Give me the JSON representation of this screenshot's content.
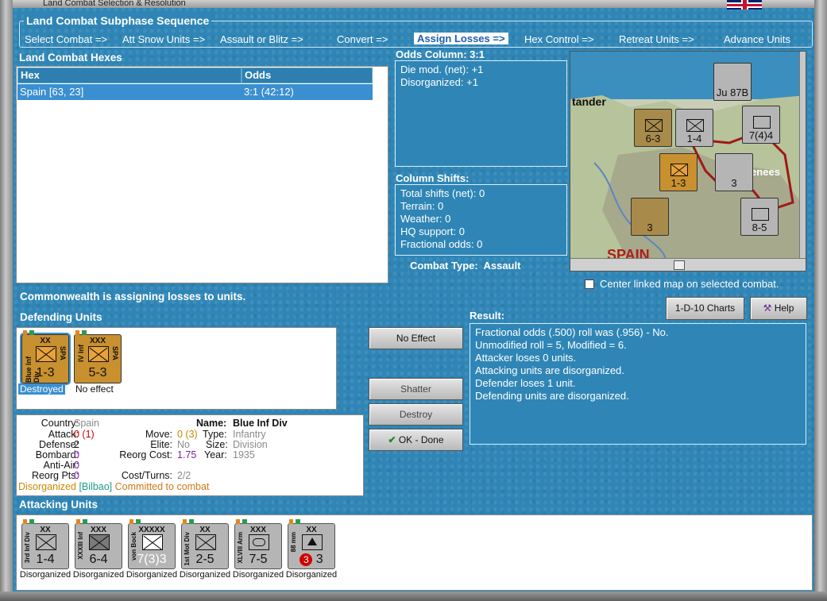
{
  "window": {
    "title": "Land Combat Selection & Resolution"
  },
  "sequence": {
    "title": "Land Combat Subphase Sequence",
    "steps": [
      "Select Combat =>",
      "Att Snow Units =>",
      "Assault or Blitz =>",
      "Convert =>",
      "Assign Losses =>",
      "Hex Control =>",
      "Retreat Units =>",
      "Advance Units"
    ],
    "active_index": 4
  },
  "hexes": {
    "title": "Land Combat Hexes",
    "columns": [
      "Hex",
      "Odds"
    ],
    "rows": [
      {
        "hex": "Spain [63, 23]",
        "odds": "3:1 (42:12)"
      }
    ]
  },
  "odds": {
    "title": "Odds Column: 3:1",
    "lines": [
      "Die mod. (net): +1",
      "Disorganized: +1"
    ]
  },
  "shifts": {
    "title": "Column Shifts:",
    "lines": [
      "Total shifts (net): 0",
      "Terrain: 0",
      "Weather: 0",
      "HQ support: 0",
      "Fractional odds: 0"
    ]
  },
  "combat_type": {
    "label": "Combat Type:",
    "value": "Assault"
  },
  "map": {
    "labels": [
      "tander",
      "renees",
      "SPAIN"
    ],
    "center_checkbox_label": "Center linked map on selected combat.",
    "center_checked": false
  },
  "status_message": "Commonwealth is assigning losses to units.",
  "buttons": {
    "charts": "1-D-10 Charts",
    "help": "Help",
    "no_effect": "No Effect",
    "shatter": "Shatter",
    "destroy": "Destroy",
    "ok": "OK - Done"
  },
  "defending": {
    "title": "Defending Units",
    "units": [
      {
        "side_label": "Blue Inf Div",
        "size": "XX",
        "nation": "SPA",
        "strength": "1-3",
        "status": "Destroyed",
        "selected": true
      },
      {
        "side_label": "IV Inf",
        "size": "XXX",
        "nation": "SPA",
        "strength": "5-3",
        "status": "No effect",
        "selected": false
      }
    ]
  },
  "details": {
    "country_label": "Country:",
    "country": "Spain",
    "attack_label": "Attack:",
    "attack": "0 (1)",
    "defense_label": "Defense:",
    "defense": "2",
    "bombard_label": "Bombard:",
    "bombard": "0",
    "antiair_label": "Anti-Air:",
    "antiair": "0",
    "reorg_label": "Reorg Pts:",
    "reorg": "0",
    "name_label": "Name:",
    "name": "Blue Inf Div",
    "move_label": "Move:",
    "move": "0 (3)",
    "elite_label": "Elite:",
    "elite": "No",
    "reorg_cost_label": "Reorg Cost:",
    "reorg_cost": "1.75",
    "cost_turns_label": "Cost/Turns:",
    "cost_turns": "2/2",
    "type_label": "Type:",
    "type": "Infantry",
    "size_label": "Size:",
    "size": "Division",
    "year_label": "Year:",
    "year": "1935",
    "flag_disorganized": "Disorganized",
    "flag_location": "[Bilbao]",
    "flag_committed": "Committed to combat"
  },
  "result": {
    "title": "Result:",
    "lines": [
      "Fractional odds (.500) roll was (.956)  - No.",
      "Unmodified roll = 5, Modified = 6.",
      "Attacker loses 0 units.",
      "Attacking units are disorganized.",
      "Defender loses 1 unit.",
      "Defending units are disorganized."
    ]
  },
  "attacking": {
    "title": "Attacking Units",
    "units": [
      {
        "side_label": "3rd Inf Div",
        "size": "XX",
        "strength": "1-4",
        "status": "Disorganized",
        "kind": "inf"
      },
      {
        "side_label": "XXXIII Inf",
        "size": "XXX",
        "strength": "6-4",
        "status": "Disorganized",
        "kind": "inf-dark"
      },
      {
        "side_label": "von Bock",
        "size": "XXXXX",
        "strength": "7(3)3",
        "status": "Disorganized",
        "kind": "inf"
      },
      {
        "side_label": "1st Mot Div",
        "size": "XX",
        "strength": "2-5",
        "status": "Disorganized",
        "kind": "mot"
      },
      {
        "side_label": "XLVIII Arm",
        "size": "XXX",
        "strength": "7-5",
        "status": "Disorganized",
        "kind": "arm"
      },
      {
        "side_label": "88 mm",
        "size": "XX",
        "strength": "3",
        "badge": "3",
        "status": "Disorganized",
        "kind": "aa"
      }
    ]
  }
}
